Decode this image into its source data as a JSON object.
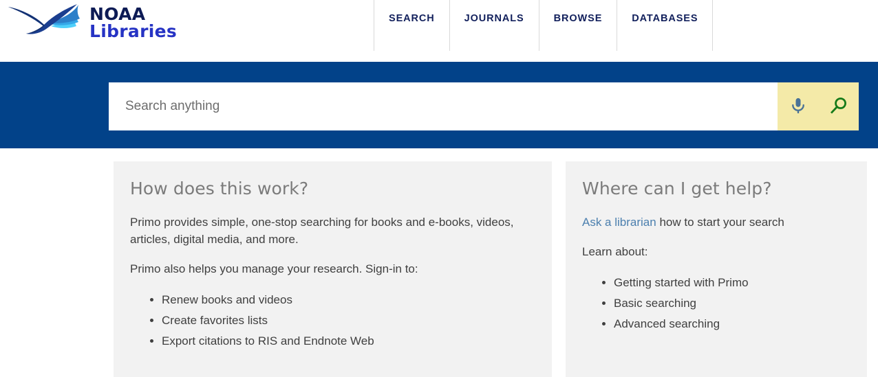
{
  "brand": {
    "name": "NOAA Libraries",
    "line1": "NOAA",
    "line2": "Libraries",
    "logo_icon": "noaa-seagull-logo",
    "colors": {
      "line1": "#0d1b55",
      "line2": "#2633c4",
      "bird_dark": "#1b3b8b",
      "bird_mid": "#2f7fd0",
      "bird_light": "#3fc3f5"
    }
  },
  "nav": {
    "items": [
      {
        "label": "SEARCH"
      },
      {
        "label": "JOURNALS"
      },
      {
        "label": "BROWSE"
      },
      {
        "label": "DATABASES"
      }
    ]
  },
  "search": {
    "placeholder": "Search anything",
    "value": "",
    "mic_icon": "microphone-icon",
    "submit_icon": "magnifier-icon",
    "band_color": "#024289",
    "actions_bg": "#f4eaa8",
    "mic_color": "#4a7296",
    "magnifier_color": "#157a19"
  },
  "cards": {
    "left": {
      "title": "How does this work?",
      "paragraphs": [
        "Primo provides simple, one-stop searching for books and e-books, videos, articles, digital media, and more.",
        "Primo also helps you manage your research. Sign-in to:"
      ],
      "list": [
        "Renew books and videos",
        "Create favorites lists",
        "Export citations to RIS and Endnote Web"
      ]
    },
    "right": {
      "title": "Where can I get help?",
      "help_link_text": "Ask a librarian",
      "help_line_rest": " how to start your search",
      "learn_label": "Learn about:",
      "list": [
        "Getting started with Primo",
        "Basic searching",
        "Advanced searching"
      ]
    }
  }
}
